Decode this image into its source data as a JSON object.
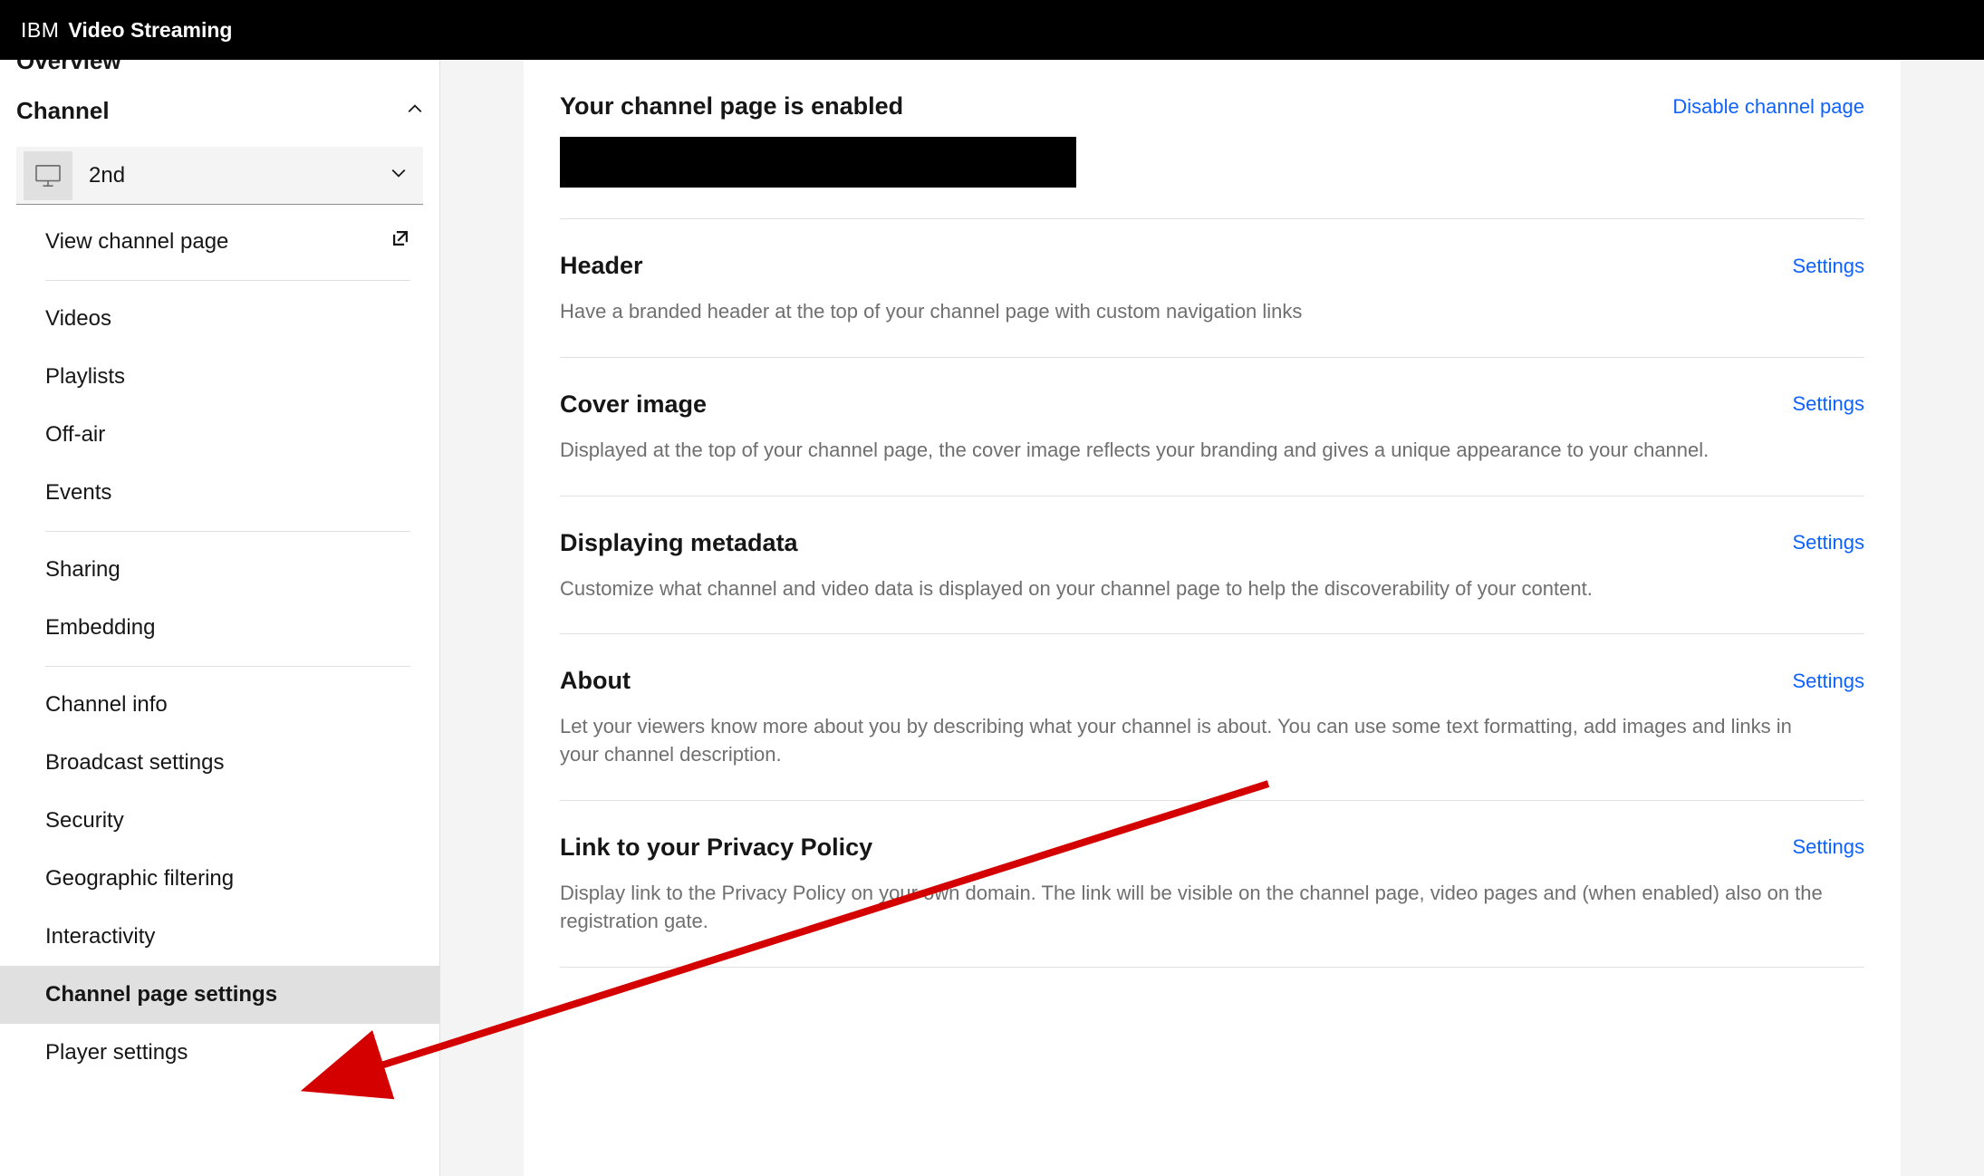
{
  "brand": {
    "ibm": "IBM",
    "product": "Video Streaming"
  },
  "sidebar": {
    "overview_label": "Overview",
    "section_label": "Channel",
    "selected_channel": "2nd",
    "groups": [
      [
        {
          "label": "View channel page",
          "external": true
        }
      ],
      [
        {
          "label": "Videos"
        },
        {
          "label": "Playlists"
        },
        {
          "label": "Off-air"
        },
        {
          "label": "Events"
        }
      ],
      [
        {
          "label": "Sharing"
        },
        {
          "label": "Embedding"
        }
      ],
      [
        {
          "label": "Channel info"
        },
        {
          "label": "Broadcast settings"
        },
        {
          "label": "Security"
        },
        {
          "label": "Geographic filtering"
        },
        {
          "label": "Interactivity"
        },
        {
          "label": "Channel page settings",
          "active": true
        },
        {
          "label": "Player settings"
        }
      ]
    ]
  },
  "content": {
    "status_panel": {
      "title": "Your channel page is enabled",
      "action": "Disable channel page"
    },
    "panels": [
      {
        "title": "Header",
        "desc": "Have a branded header at the top of your channel page with custom navigation links",
        "action": "Settings"
      },
      {
        "title": "Cover image",
        "desc": "Displayed at the top of your channel page, the cover image reflects your branding and gives a unique appearance to your channel.",
        "action": "Settings"
      },
      {
        "title": "Displaying metadata",
        "desc": "Customize what channel and video data is displayed on your channel page to help the discoverability of your content.",
        "action": "Settings"
      },
      {
        "title": "About",
        "desc": "Let your viewers know more about you by describing what your channel is about. You can use some text formatting, add images and links in your channel description.",
        "action": "Settings"
      },
      {
        "title": "Link to your Privacy Policy",
        "desc": "Display link to the Privacy Policy on your own domain. The link will be visible on the channel page, video pages and (when enabled) also on the registration gate.",
        "action": "Settings"
      }
    ]
  }
}
